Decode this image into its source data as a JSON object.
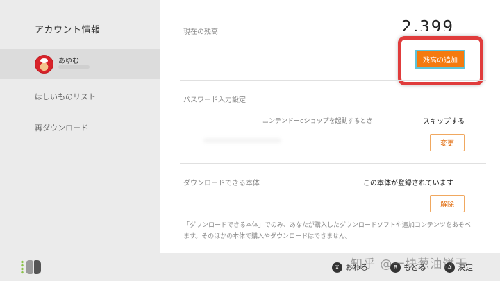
{
  "sidebar": {
    "title": "アカウント情報",
    "account": {
      "name": "あゆむ"
    },
    "items": [
      {
        "label": "ほしいものリスト"
      },
      {
        "label": "再ダウンロード"
      }
    ]
  },
  "main": {
    "balance": {
      "label": "現在の残高",
      "value": "2,399",
      "add_button": "残高の追加"
    },
    "password": {
      "label": "パスワード入力設定",
      "row_text": "ニンテンドーeショップを起動するとき",
      "row_value": "スキップする",
      "change_button": "変更"
    },
    "device": {
      "label": "ダウンロードできる本体",
      "status": "この本体が登録されています",
      "release_button": "解除",
      "note": "「ダウンロードできる本体」でのみ、あなたが購入したダウンロードソフトや追加コンテンツをあそべます。そのほかの本体で購入やダウンロードはできません。"
    }
  },
  "footer": {
    "actions": [
      {
        "glyph": "X",
        "label": "おわる"
      },
      {
        "glyph": "B",
        "label": "もどる"
      },
      {
        "glyph": "A",
        "label": "決定"
      }
    ],
    "watermark": "知乎 @一块葱油饼干"
  },
  "colors": {
    "accent_orange": "#f47a0f",
    "highlight_red": "#e03c3c",
    "focus_cyan": "#5fc4d9"
  },
  "icons": [
    "avatar-mario",
    "joycon-icon",
    "x-button-icon",
    "b-button-icon",
    "a-button-icon"
  ]
}
